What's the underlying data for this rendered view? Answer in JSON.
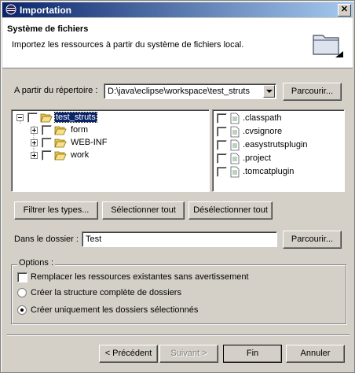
{
  "window": {
    "title": "Importation",
    "close_label": "✕"
  },
  "banner": {
    "title": "Système de fichiers",
    "description": "Importez les ressources à partir du système de fichiers local."
  },
  "source": {
    "label": "A partir du répertoire :",
    "value": "D:\\java\\eclipse\\workspace\\test_struts",
    "browse_label": "Parcourir..."
  },
  "tree": [
    {
      "label": "test_struts",
      "expanded": true,
      "selected": true
    },
    {
      "label": "form"
    },
    {
      "label": "WEB-INF"
    },
    {
      "label": "work"
    }
  ],
  "files": [
    ".classpath",
    ".cvsignore",
    ".easystrutsplugin",
    ".project",
    ".tomcatplugin"
  ],
  "buttons": {
    "filter": "Filtrer les types...",
    "select_all": "Sélectionner tout",
    "deselect_all": "Désélectionner tout"
  },
  "destination": {
    "label": "Dans le dossier :",
    "value": "Test",
    "browse_label": "Parcourir..."
  },
  "options": {
    "title": "Options :",
    "overwrite": "Remplacer les ressources existantes sans avertissement",
    "create_full": "Créer la structure complète de dossiers",
    "create_selected": "Créer uniquement les dossiers sélectionnés"
  },
  "footer": {
    "previous": "< Précédent",
    "next": "Suivant >",
    "finish": "Fin",
    "cancel": "Annuler"
  }
}
